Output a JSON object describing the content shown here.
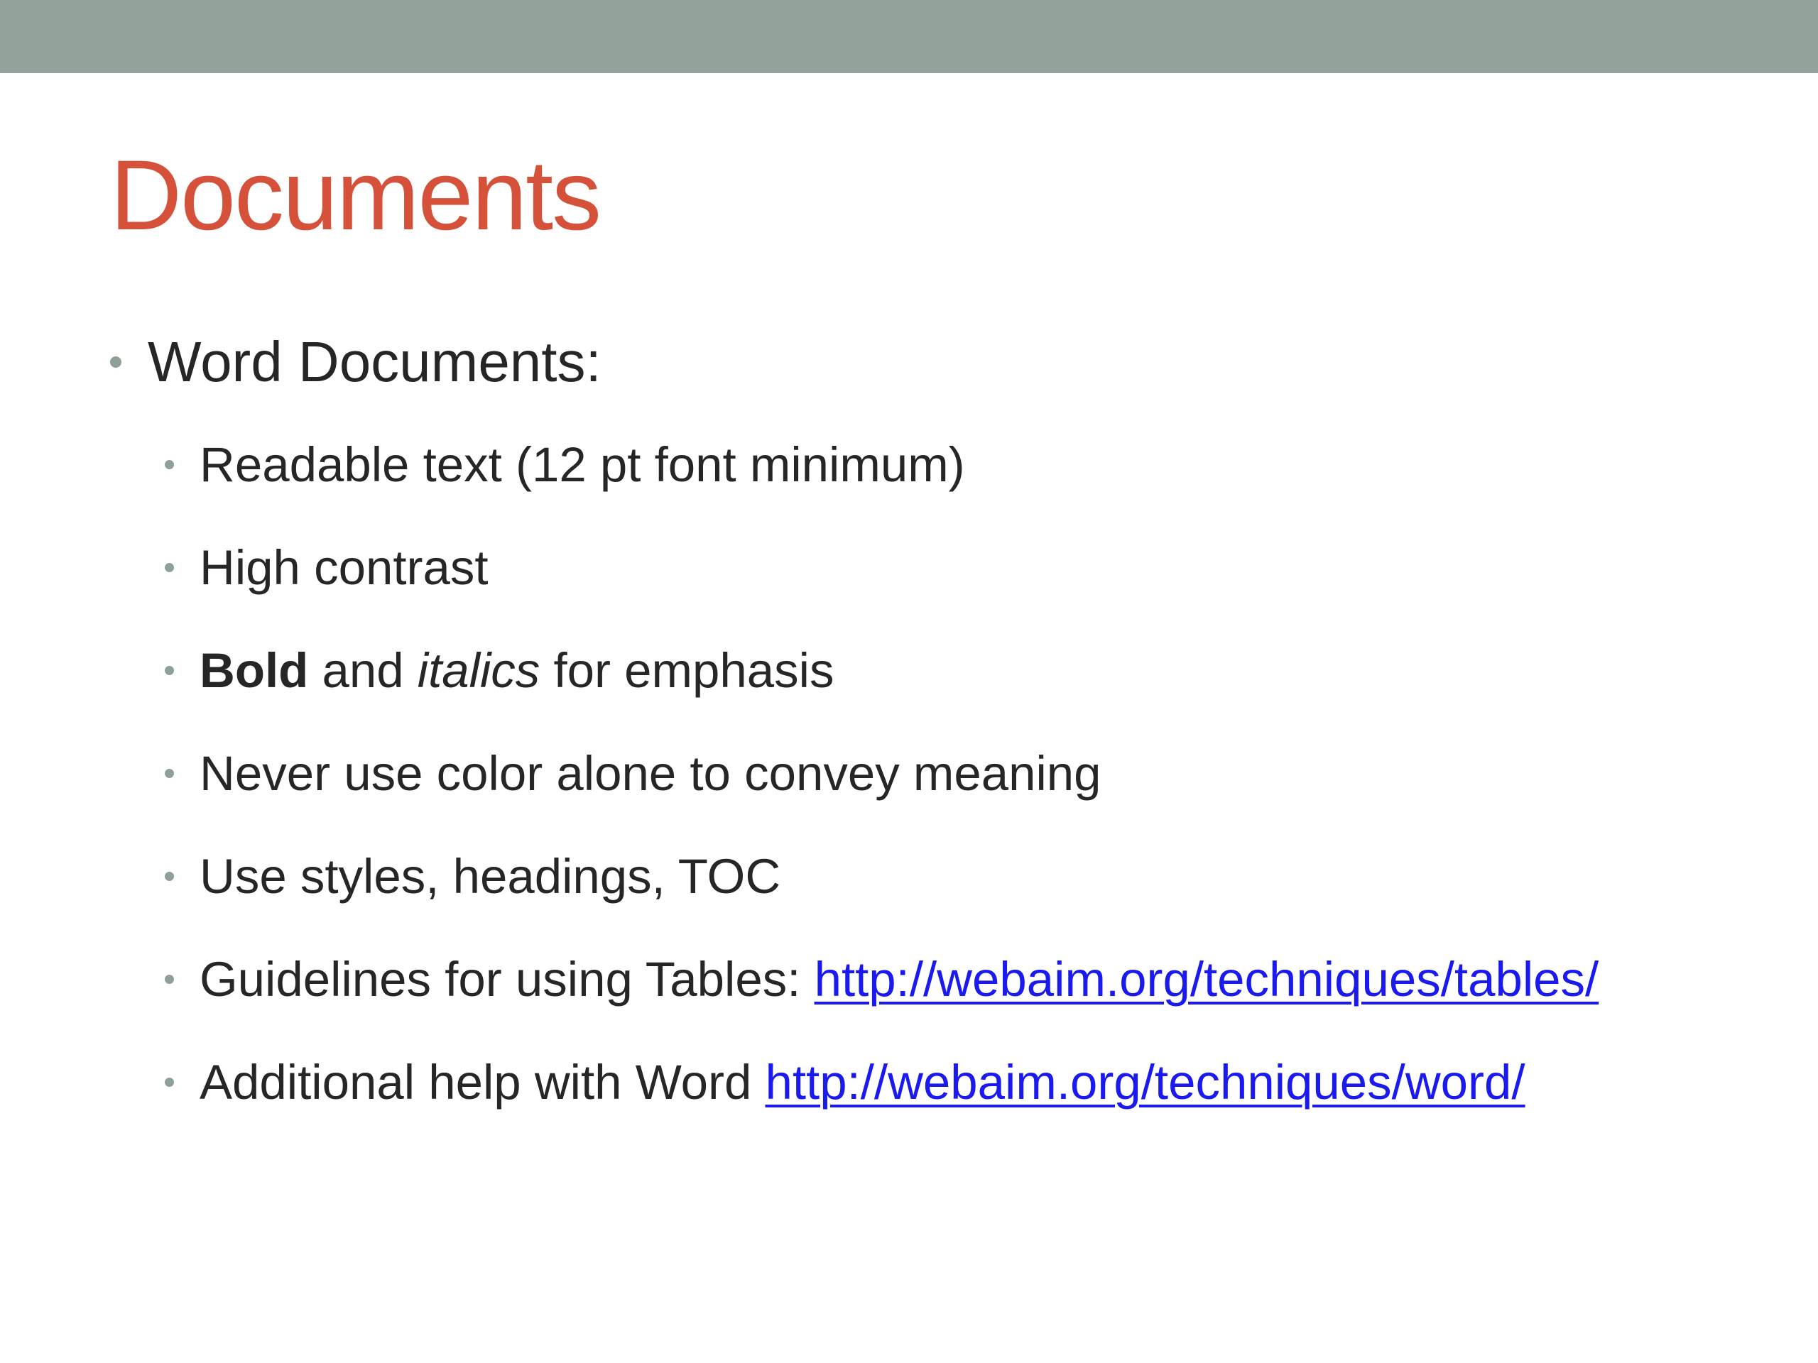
{
  "header": {
    "bar_color": "#93a29a"
  },
  "slide": {
    "title": "Documents",
    "title_color": "#d6513a",
    "main_bullet": "Word Documents:",
    "items": {
      "readable": "Readable text (12 pt font minimum)",
      "contrast": "High contrast",
      "emphasis": {
        "bold": "Bold",
        "and": " and ",
        "italic": "italics",
        "rest": " for emphasis"
      },
      "color": "Never use color alone to convey meaning",
      "styles": "Use styles, headings, TOC",
      "tables": {
        "label": "Guidelines for using Tables: ",
        "link": "http://webaim.org/techniques/tables/"
      },
      "word": {
        "label": "Additional help with Word ",
        "link": "http://webaim.org/techniques/word/"
      }
    }
  }
}
